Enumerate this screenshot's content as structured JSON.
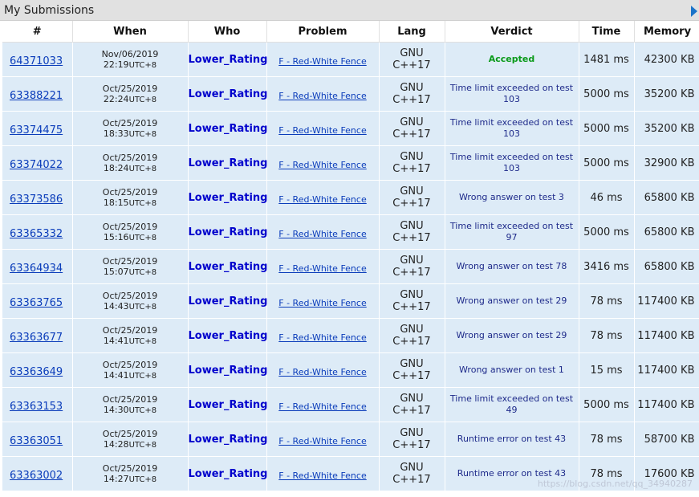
{
  "header": {
    "title": "My Submissions"
  },
  "columns": [
    "#",
    "When",
    "Who",
    "Problem",
    "Lang",
    "Verdict",
    "Time",
    "Memory"
  ],
  "rows": [
    {
      "id": "64371033",
      "date": "Nov/06/2019",
      "time": "22:19",
      "tz": "UTC+8",
      "who": "Lower_Rating",
      "problem": "F - Red-White Fence",
      "lang1": "GNU",
      "lang2": "C++17",
      "verdict": "Accepted",
      "accepted": true,
      "time_ms": "1481 ms",
      "memory": "42300 KB"
    },
    {
      "id": "63388221",
      "date": "Oct/25/2019",
      "time": "22:24",
      "tz": "UTC+8",
      "who": "Lower_Rating",
      "problem": "F - Red-White Fence",
      "lang1": "GNU",
      "lang2": "C++17",
      "verdict": "Time limit exceeded on test 103",
      "accepted": false,
      "time_ms": "5000 ms",
      "memory": "35200 KB"
    },
    {
      "id": "63374475",
      "date": "Oct/25/2019",
      "time": "18:33",
      "tz": "UTC+8",
      "who": "Lower_Rating",
      "problem": "F - Red-White Fence",
      "lang1": "GNU",
      "lang2": "C++17",
      "verdict": "Time limit exceeded on test 103",
      "accepted": false,
      "time_ms": "5000 ms",
      "memory": "35200 KB"
    },
    {
      "id": "63374022",
      "date": "Oct/25/2019",
      "time": "18:24",
      "tz": "UTC+8",
      "who": "Lower_Rating",
      "problem": "F - Red-White Fence",
      "lang1": "GNU",
      "lang2": "C++17",
      "verdict": "Time limit exceeded on test 103",
      "accepted": false,
      "time_ms": "5000 ms",
      "memory": "32900 KB"
    },
    {
      "id": "63373586",
      "date": "Oct/25/2019",
      "time": "18:15",
      "tz": "UTC+8",
      "who": "Lower_Rating",
      "problem": "F - Red-White Fence",
      "lang1": "GNU",
      "lang2": "C++17",
      "verdict": "Wrong answer on test 3",
      "accepted": false,
      "time_ms": "46 ms",
      "memory": "65800 KB"
    },
    {
      "id": "63365332",
      "date": "Oct/25/2019",
      "time": "15:16",
      "tz": "UTC+8",
      "who": "Lower_Rating",
      "problem": "F - Red-White Fence",
      "lang1": "GNU",
      "lang2": "C++17",
      "verdict": "Time limit exceeded on test 97",
      "accepted": false,
      "time_ms": "5000 ms",
      "memory": "65800 KB"
    },
    {
      "id": "63364934",
      "date": "Oct/25/2019",
      "time": "15:07",
      "tz": "UTC+8",
      "who": "Lower_Rating",
      "problem": "F - Red-White Fence",
      "lang1": "GNU",
      "lang2": "C++17",
      "verdict": "Wrong answer on test 78",
      "accepted": false,
      "time_ms": "3416 ms",
      "memory": "65800 KB"
    },
    {
      "id": "63363765",
      "date": "Oct/25/2019",
      "time": "14:43",
      "tz": "UTC+8",
      "who": "Lower_Rating",
      "problem": "F - Red-White Fence",
      "lang1": "GNU",
      "lang2": "C++17",
      "verdict": "Wrong answer on test 29",
      "accepted": false,
      "time_ms": "78 ms",
      "memory": "117400 KB"
    },
    {
      "id": "63363677",
      "date": "Oct/25/2019",
      "time": "14:41",
      "tz": "UTC+8",
      "who": "Lower_Rating",
      "problem": "F - Red-White Fence",
      "lang1": "GNU",
      "lang2": "C++17",
      "verdict": "Wrong answer on test 29",
      "accepted": false,
      "time_ms": "78 ms",
      "memory": "117400 KB"
    },
    {
      "id": "63363649",
      "date": "Oct/25/2019",
      "time": "14:41",
      "tz": "UTC+8",
      "who": "Lower_Rating",
      "problem": "F - Red-White Fence",
      "lang1": "GNU",
      "lang2": "C++17",
      "verdict": "Wrong answer on test 1",
      "accepted": false,
      "time_ms": "15 ms",
      "memory": "117400 KB"
    },
    {
      "id": "63363153",
      "date": "Oct/25/2019",
      "time": "14:30",
      "tz": "UTC+8",
      "who": "Lower_Rating",
      "problem": "F - Red-White Fence",
      "lang1": "GNU",
      "lang2": "C++17",
      "verdict": "Time limit exceeded on test 49",
      "accepted": false,
      "time_ms": "5000 ms",
      "memory": "117400 KB"
    },
    {
      "id": "63363051",
      "date": "Oct/25/2019",
      "time": "14:28",
      "tz": "UTC+8",
      "who": "Lower_Rating",
      "problem": "F - Red-White Fence",
      "lang1": "GNU",
      "lang2": "C++17",
      "verdict": "Runtime error on test 43",
      "accepted": false,
      "time_ms": "78 ms",
      "memory": "58700 KB"
    },
    {
      "id": "63363002",
      "date": "Oct/25/2019",
      "time": "14:27",
      "tz": "UTC+8",
      "who": "Lower_Rating",
      "problem": "F - Red-White Fence",
      "lang1": "GNU",
      "lang2": "C++17",
      "verdict": "Runtime error on test 43",
      "accepted": false,
      "time_ms": "78 ms",
      "memory": "17600 KB"
    }
  ],
  "watermark": "https://blog.csdn.net/qq_34940287",
  "colors": {
    "row_bg": "#ddebf7",
    "link": "#0a3cba",
    "accepted": "#0a9a1a",
    "who": "#0000cc"
  }
}
